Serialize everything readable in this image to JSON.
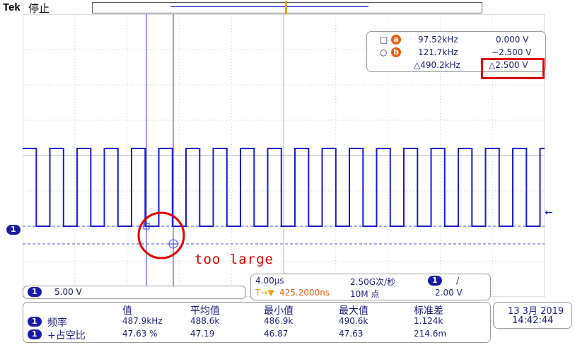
{
  "header": {
    "brand": "Tek",
    "status": "停止"
  },
  "markers": {
    "cursor_a": "a",
    "cursor_b": "b",
    "trigger": "T",
    "channel": "1"
  },
  "cursor_readout": {
    "a_freq": "97.52kHz",
    "a_volt": "0.000 V",
    "b_freq": "121.7kHz",
    "b_volt": "−2.500 V",
    "delta_freq": "△490.2kHz",
    "delta_volt": "△2.500 V"
  },
  "annotation": "too large",
  "channel_scale": {
    "channel": "1",
    "value": "5.00 V"
  },
  "timebase": {
    "time_div": "4.00µs",
    "sample_rate": "2.50G次/秒",
    "trigger_pos": "425.2000ns",
    "record": "10M 点",
    "trig_channel": "1",
    "trig_slope": "/",
    "trig_level": "2.00 V"
  },
  "measurements": {
    "headers": [
      "值",
      "平均值",
      "最小值",
      "最大值",
      "标准差"
    ],
    "rows": [
      {
        "channel": "1",
        "name": "频率",
        "values": [
          "487.9kHz",
          "488.6k",
          "486.9k",
          "490.6k",
          "1.124k"
        ]
      },
      {
        "channel": "1",
        "name": "+占空比",
        "values": [
          "47.63 %",
          "47.19",
          "46.87",
          "47.63",
          "214.6m"
        ]
      }
    ]
  },
  "datetime": {
    "date": "13 3月 2019",
    "time": "14:42:44"
  },
  "colors": {
    "trace": "#1a1ad0",
    "highlight": "#e00000",
    "cursor_orange": "#e86010"
  }
}
